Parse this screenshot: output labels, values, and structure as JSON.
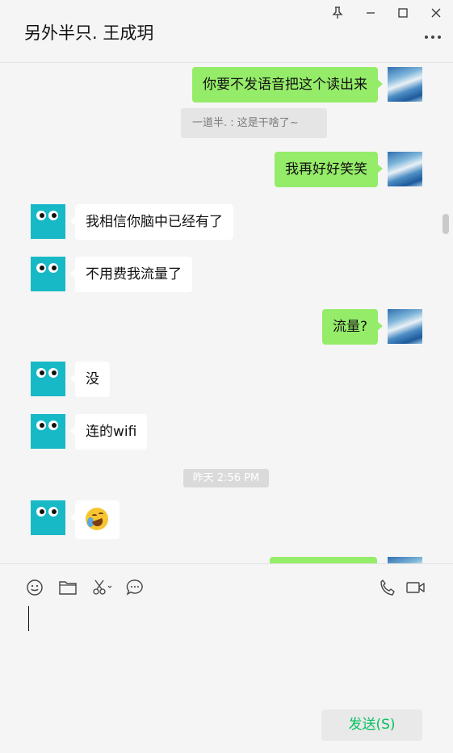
{
  "header": {
    "title": "另外半只. 王成玥"
  },
  "messages": [
    {
      "from": "me",
      "text": "你要不发语音把这个读出来"
    },
    {
      "type": "quote",
      "text": "一道半. : 这是干啥了~"
    },
    {
      "from": "me",
      "text": "我再好好笑笑"
    },
    {
      "from": "peer",
      "text": "我相信你脑中已经有了"
    },
    {
      "from": "peer",
      "text": "不用费我流量了"
    },
    {
      "from": "me",
      "text": "流量?"
    },
    {
      "from": "peer",
      "text": "没"
    },
    {
      "from": "peer",
      "text": "连的wifi"
    },
    {
      "type": "time",
      "text": "昨天 2:56 PM"
    },
    {
      "from": "peer",
      "emoji": "rolling-laughing-emoji"
    }
  ],
  "input": {
    "send_label": "发送(S)"
  },
  "colors": {
    "my_bubble": "#95ec69",
    "peer_bubble": "#ffffff",
    "send_text": "#07c160",
    "peer_avatar": "#18b9c7"
  }
}
